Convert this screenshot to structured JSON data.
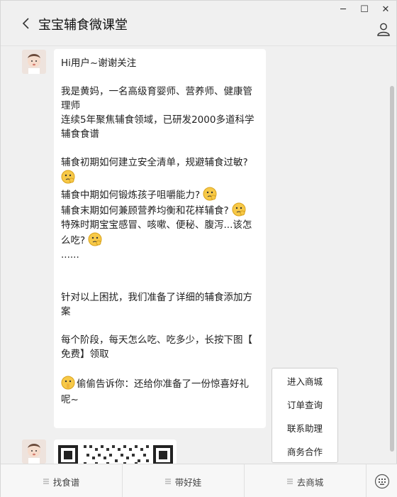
{
  "window": {
    "minimize": "─",
    "maximize": "☐",
    "close": "✕"
  },
  "header": {
    "title": "宝宝辅食微课堂"
  },
  "messages": {
    "lines": [
      "Hi用户~谢谢关注",
      "",
      "我是黄妈，一名高级育婴师、营养师、健康管",
      "理师",
      "连续5年聚焦辅食领域，已研发2000多道科学",
      "辅食食谱",
      "",
      "辅食初期如何建立安全清单，规避辅食过敏?",
      "",
      "辅食中期如何锻炼孩子咀嚼能力?",
      "辅食末期如何兼顾营养均衡和花样辅食?",
      "特殊时期宝宝感冒、咳嗽、便秘、腹泻...该怎",
      "么吃?",
      "......",
      "",
      "",
      "针对以上困扰，我们准备了详细的辅食添加方",
      "案",
      "",
      "每个阶段，每天怎么吃、吃多少，长按下图【",
      "免费】领取",
      "",
      "偷偷告诉你：还给你准备了一份惊喜好礼",
      "呢~"
    ]
  },
  "popup_menu": {
    "items": [
      "进入商城",
      "订单查询",
      "联系助理",
      "商务合作"
    ]
  },
  "bottom_tabs": [
    "找食谱",
    "带好娃",
    "去商城"
  ]
}
